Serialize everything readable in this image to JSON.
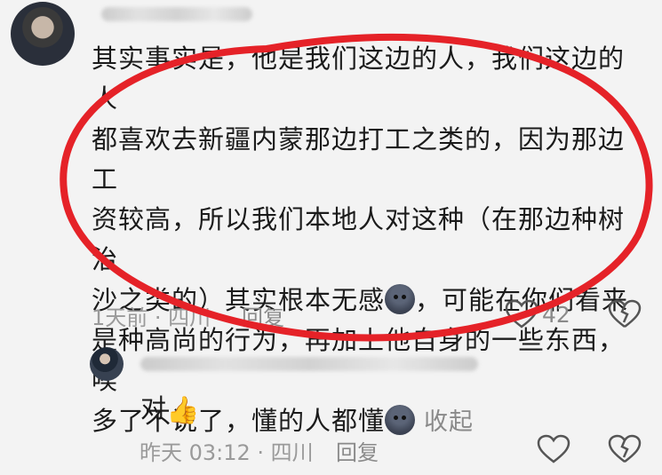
{
  "main_comment": {
    "text": "其实事实是，他是我们这边的人，我们这边的人\n都喜欢去新疆内蒙那边打工之类的，因为那边工\n资较高，所以我们本地人对这种（在那边种树治\n沙之类的）其实根本无感",
    "text_2": "，可能在你们看来\n是种高尚的行为，再加上他自身的一些东西，唉\n多了不说了，懂的人都懂",
    "collapse_label": "收起",
    "time_location": "1天前 · 四川",
    "reply_label": "回复",
    "like_count": "42"
  },
  "reply_comment": {
    "text": "对",
    "time_location": "昨天 03:12 · 四川",
    "reply_label": "回复"
  },
  "icons": {
    "emoji": "face-emoji",
    "thumbs_up": "👍",
    "like": "heart-icon",
    "dislike": "broken-heart-icon"
  },
  "colors": {
    "annotation_circle": "#e52228",
    "meta_text": "#9a9a9a"
  }
}
